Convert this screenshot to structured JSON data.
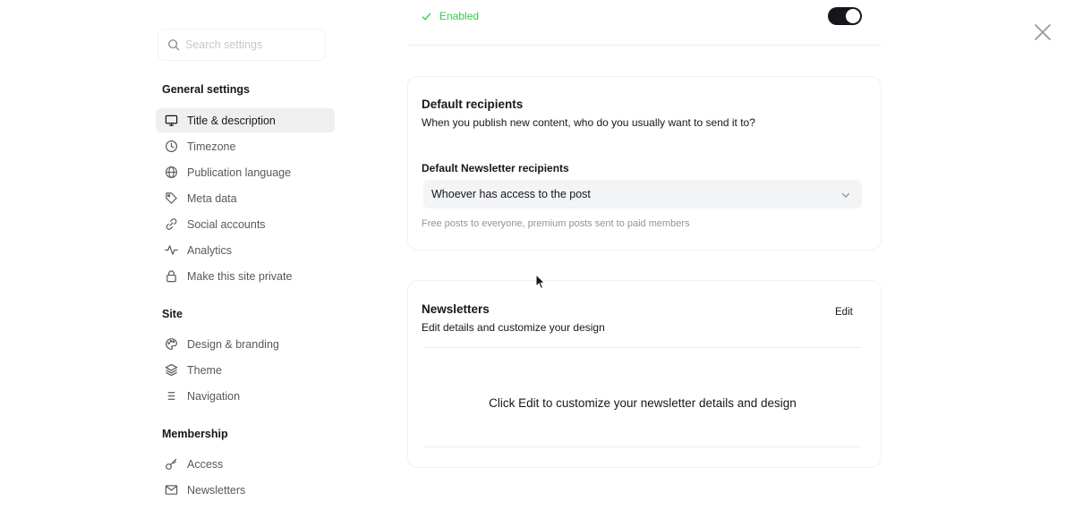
{
  "window": {
    "close_icon": "close-icon"
  },
  "sidebar": {
    "search_placeholder": "Search settings",
    "sections": [
      {
        "title": "General settings"
      },
      {
        "title": "Site"
      },
      {
        "title": "Membership"
      }
    ],
    "items": [
      {
        "label": "Title & description",
        "icon": "monitor-icon",
        "active": true
      },
      {
        "label": "Timezone",
        "icon": "clock-icon"
      },
      {
        "label": "Publication language",
        "icon": "globe-icon"
      },
      {
        "label": "Meta data",
        "icon": "tag-icon"
      },
      {
        "label": "Social accounts",
        "icon": "link-icon"
      },
      {
        "label": "Analytics",
        "icon": "pulse-icon"
      },
      {
        "label": "Make this site private",
        "icon": "lock-icon"
      },
      {
        "label": "Design & branding",
        "icon": "palette-icon"
      },
      {
        "label": "Theme",
        "icon": "layers-icon"
      },
      {
        "label": "Navigation",
        "icon": "menu-icon"
      },
      {
        "label": "Access",
        "icon": "key-icon"
      },
      {
        "label": "Newsletters",
        "icon": "mail-icon"
      }
    ]
  },
  "main": {
    "enabled": {
      "status": "Enabled",
      "toggle_on": true,
      "accent": "#30cf43"
    },
    "default_recipients": {
      "title": "Default recipients",
      "description": "When you publish new content, who do you usually want to send it to?",
      "field_label": "Default Newsletter recipients",
      "selected": "Whoever has access to the post",
      "hint": "Free posts to everyone, premium posts sent to paid members"
    },
    "newsletters": {
      "title": "Newsletters",
      "description": "Edit details and customize your design",
      "edit_label": "Edit",
      "empty_message": "Click Edit to customize your newsletter details and design"
    }
  }
}
